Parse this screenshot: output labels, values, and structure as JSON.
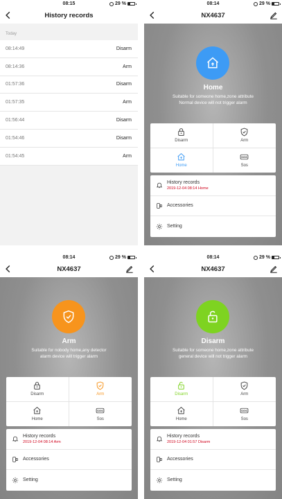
{
  "colors": {
    "home": "#3d9bf5",
    "arm": "#f7941d",
    "disarm": "#7ed321",
    "red": "#d0021b"
  },
  "history_screen": {
    "time": "08:15",
    "battery": "29 %",
    "title": "History records",
    "section": "Today",
    "rows": [
      {
        "time": "08:14:49",
        "state": "Disarm"
      },
      {
        "time": "08:14:36",
        "state": "Arm"
      },
      {
        "time": "01:57:36",
        "state": "Disarm"
      },
      {
        "time": "01:57:35",
        "state": "Arm"
      },
      {
        "time": "01:56:44",
        "state": "Disarm"
      },
      {
        "time": "01:54:46",
        "state": "Disarm"
      },
      {
        "time": "01:54:45",
        "state": "Arm"
      }
    ]
  },
  "home_screen": {
    "time": "08:14",
    "battery": "29 %",
    "title": "NX4637",
    "mode": "Home",
    "desc1": "Suitable for someone home,zone attribute",
    "desc2": "Normal device will not trigger alarm",
    "history_label": "History records",
    "history_sub": "2019-12-04 08:14 Home",
    "accessories": "Accessories",
    "setting": "Setting"
  },
  "arm_screen": {
    "time": "08:14",
    "battery": "29 %",
    "title": "NX4637",
    "mode": "Arm",
    "desc1": "Suitable for nobody home,any detector",
    "desc2": "alarm device will trigger alarm",
    "history_label": "History records",
    "history_sub": "2019-12-04 08:14 Arm",
    "accessories": "Accessories",
    "setting": "Setting"
  },
  "disarm_screen": {
    "time": "08:14",
    "battery": "29 %",
    "title": "NX4637",
    "mode": "Disarm",
    "desc1": "Suitable for someone home,zone attribute",
    "desc2": "general device will not trigger alarm",
    "history_label": "History records",
    "history_sub": "2019-12-04 01:57 Disarm",
    "accessories": "Accessories",
    "setting": "Setting"
  },
  "modes": {
    "disarm": "Disarm",
    "arm": "Arm",
    "home": "Home",
    "sos": "Sos"
  }
}
